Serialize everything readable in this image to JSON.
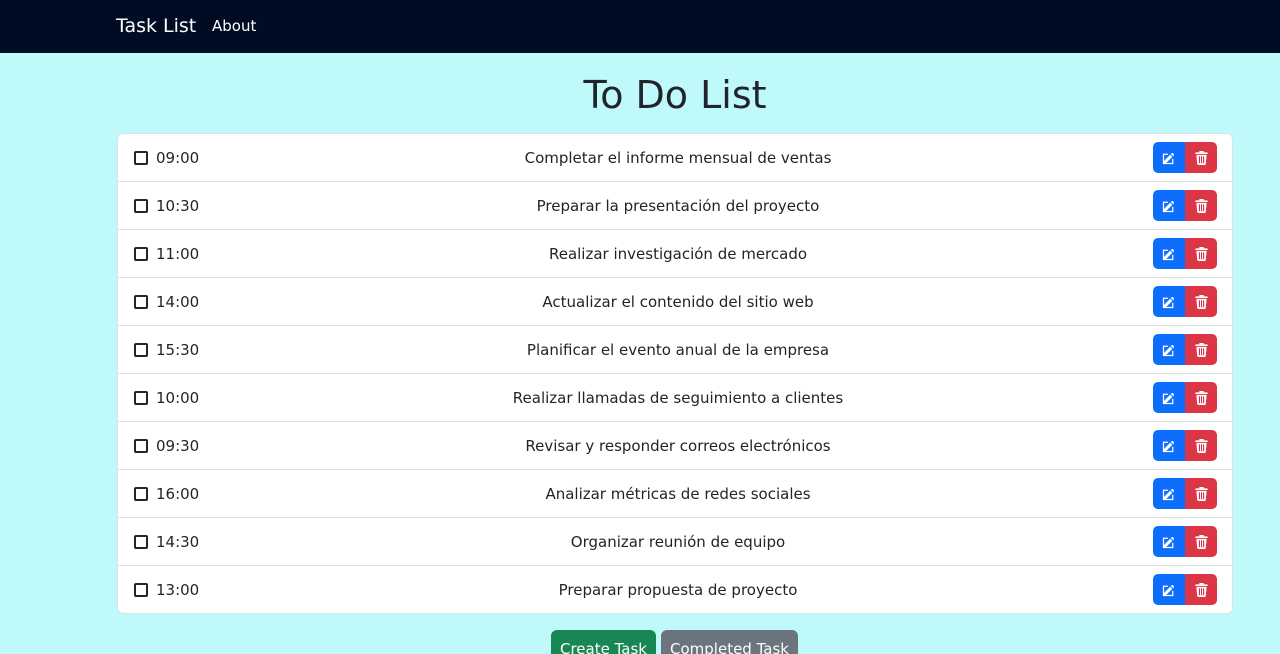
{
  "navbar": {
    "brand": "Task List",
    "about": "About"
  },
  "page_title": "To Do List",
  "tasks": [
    {
      "time": "09:00",
      "text": "Completar el informe mensual de ventas"
    },
    {
      "time": "10:30",
      "text": "Preparar la presentación del proyecto"
    },
    {
      "time": "11:00",
      "text": "Realizar investigación de mercado"
    },
    {
      "time": "14:00",
      "text": "Actualizar el contenido del sitio web"
    },
    {
      "time": "15:30",
      "text": "Planificar el evento anual de la empresa"
    },
    {
      "time": "10:00",
      "text": "Realizar llamadas de seguimiento a clientes"
    },
    {
      "time": "09:30",
      "text": "Revisar y responder correos electrónicos"
    },
    {
      "time": "16:00",
      "text": "Analizar métricas de redes sociales"
    },
    {
      "time": "14:30",
      "text": "Organizar reunión de equipo"
    },
    {
      "time": "13:00",
      "text": "Preparar propuesta de proyecto"
    }
  ],
  "icons": {
    "edit": "edit-icon",
    "delete": "trash-icon",
    "checkbox": "checkbox-unchecked"
  },
  "colors": {
    "navbar": "#000c24",
    "background": "#c0f9f9",
    "edit": "#0d6efd",
    "delete": "#dc3545",
    "create": "#198754",
    "completed": "#6c757d"
  },
  "actions": {
    "create": "Create Task",
    "completed": "Completed Task"
  }
}
